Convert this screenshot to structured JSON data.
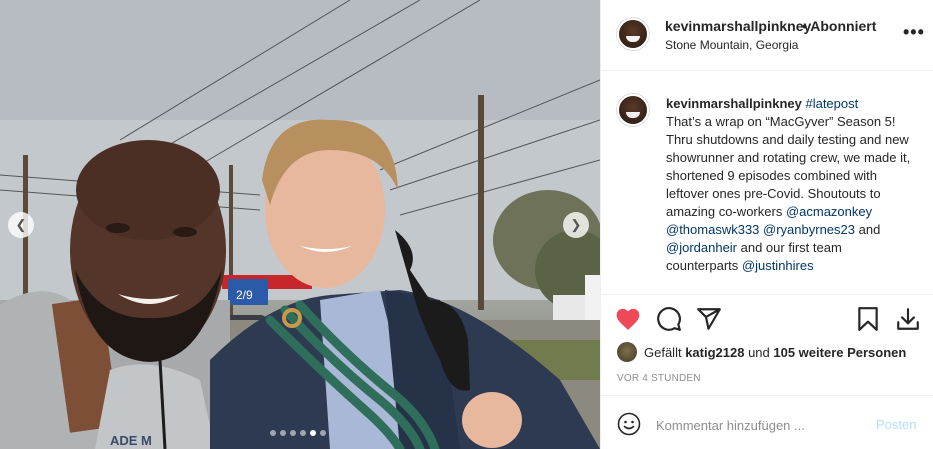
{
  "post": {
    "username": "kevinmarshallpinkney",
    "follow_status": "• Abonniert",
    "location": "Stone Mountain, Georgia",
    "more_label": "•••"
  },
  "photo": {
    "sign_text": "2/9",
    "shirt_text": "ADE M",
    "carousel_dots": 6,
    "active_dot": 4
  },
  "caption": {
    "username": "kevinmarshallpinkney",
    "hashtag": "#latepost",
    "text1": "That’s a wrap on “MacGyver” Season 5! Thru shutdowns and daily testing and new showrunner and rotating crew, we made it, shortened 9 episodes combined with leftover ones pre-Covid. Shoutouts to amazing co-workers ",
    "mention1": "@acmazonkey",
    "mention2": "@thomaswk333",
    "mention3": "@ryanbyrnes23",
    "and1": " and",
    "mention4": "@jordanheir",
    "text2": " and our first team counterparts ",
    "mention5": "@justinhires"
  },
  "likes": {
    "prefix": "Gefällt ",
    "liker": "katig2128",
    "middle": " und ",
    "others": "105 weitere Personen"
  },
  "timestamp": "VOR 4 STUNDEN",
  "comment": {
    "placeholder": "Kommentar hinzufügen ...",
    "post_label": "Posten"
  },
  "icons": {
    "like": "heart-icon",
    "comment": "comment-icon",
    "share": "share-icon",
    "save": "bookmark-icon",
    "download": "download-icon",
    "emoji": "emoji-icon"
  },
  "colors": {
    "heart": "#ed4956",
    "link": "#00376b",
    "post_button": "#b2dffc",
    "muted": "#8e8e8e"
  }
}
